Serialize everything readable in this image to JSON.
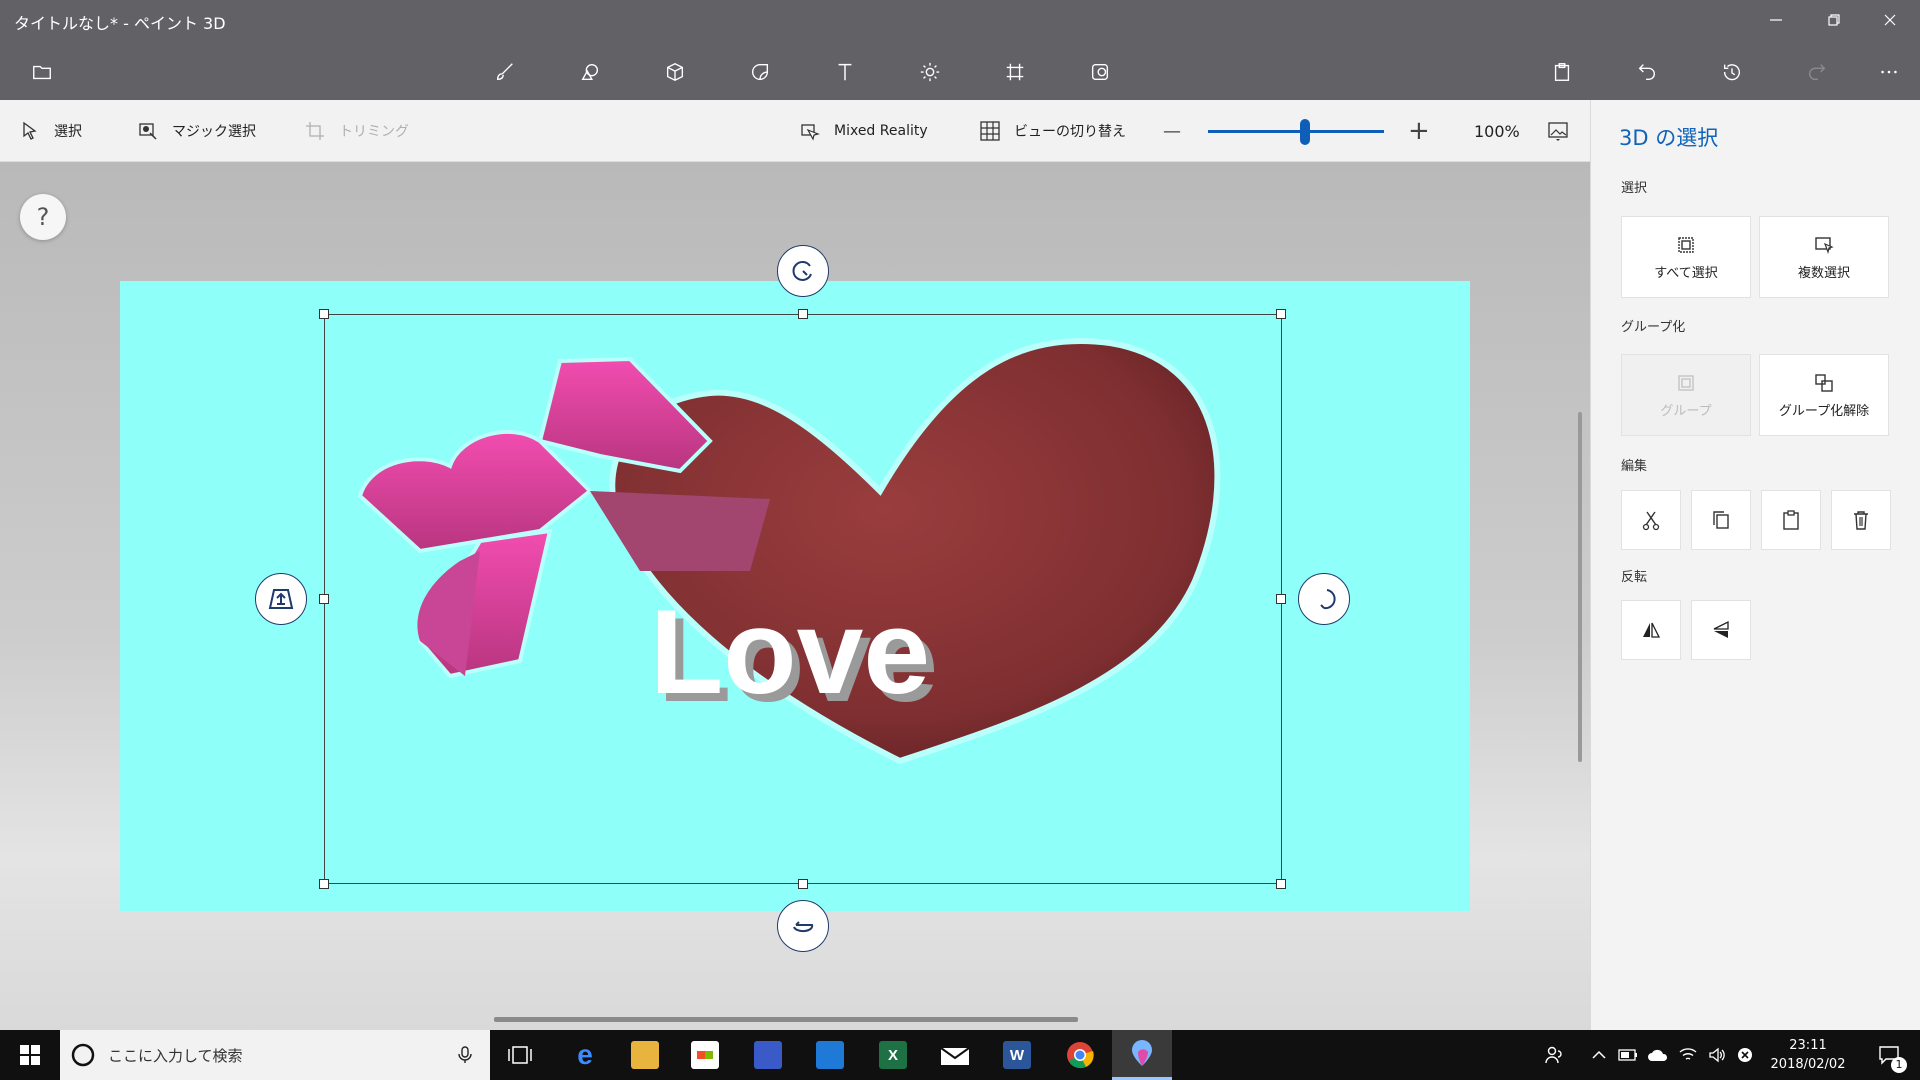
{
  "window": {
    "title": "タイトルなし* - ペイント 3D"
  },
  "subtoolbar": {
    "select_label": "選択",
    "magic_select_label": "マジック選択",
    "crop_label": "トリミング",
    "mixed_reality_label": "Mixed Reality",
    "switch_view_label": "ビューの切り替え",
    "zoom_minus": "—",
    "zoom_plus": "+",
    "zoom_level": "100%",
    "zoom_fraction": 0.55
  },
  "canvas": {
    "help_label": "?",
    "background_color": "#8efff9",
    "love_text": "Love",
    "heart_color": "#8b3336",
    "bow_color": "#e33f9e"
  },
  "panel": {
    "title": "3D の選択",
    "select_section": "選択",
    "select_all_label": "すべて選択",
    "multi_select_label": "複数選択",
    "group_section": "グループ化",
    "group_label": "グループ",
    "ungroup_label": "グループ化解除",
    "edit_section": "編集",
    "flip_section": "反転"
  },
  "taskbar": {
    "search_placeholder": "ここに入力して検索",
    "time": "23:11",
    "date": "2018/02/02",
    "notification_count": "1"
  },
  "colors": {
    "accent": "#1063b8",
    "titlebar": "#616166"
  }
}
